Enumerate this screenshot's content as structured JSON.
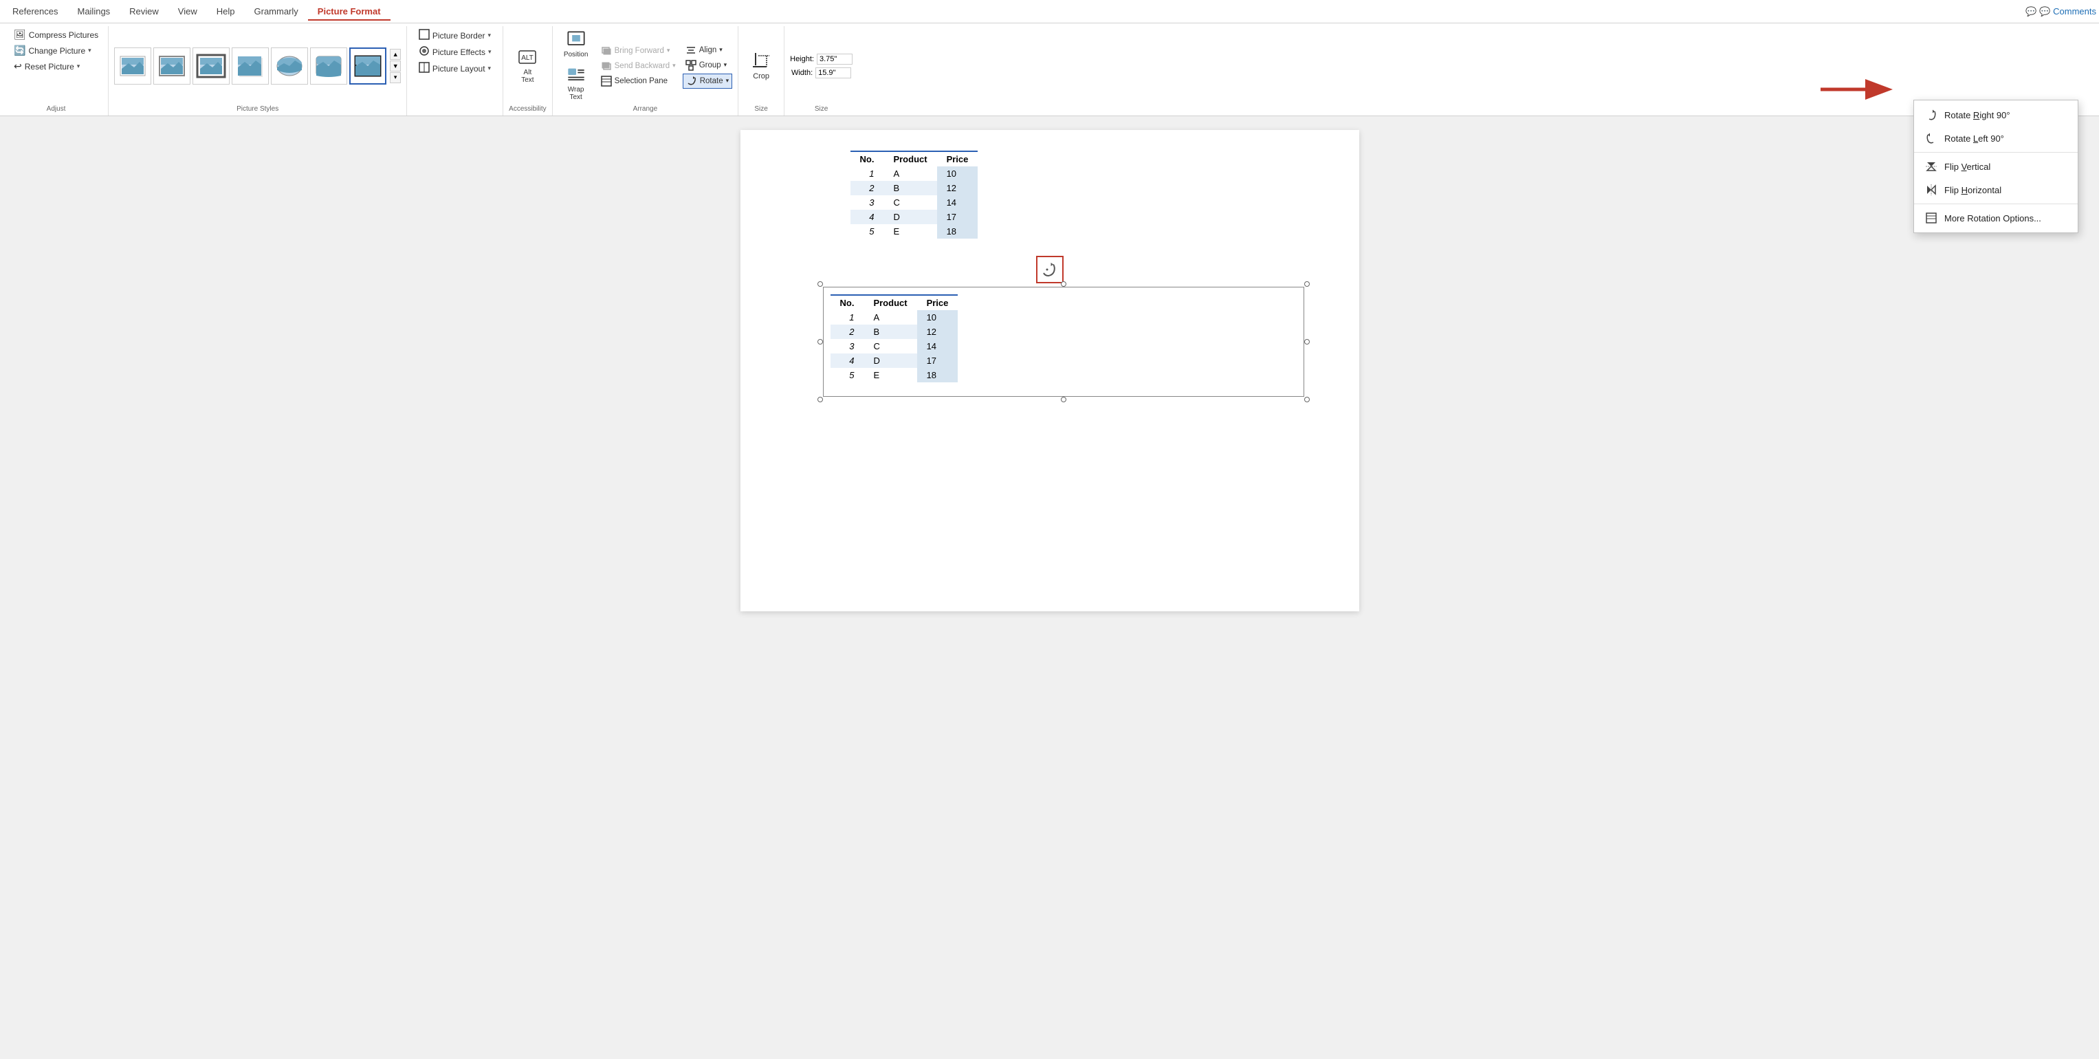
{
  "tabs": [
    {
      "label": "References",
      "active": false
    },
    {
      "label": "Mailings",
      "active": false
    },
    {
      "label": "Review",
      "active": false
    },
    {
      "label": "View",
      "active": false
    },
    {
      "label": "Help",
      "active": false
    },
    {
      "label": "Grammarly",
      "active": false
    },
    {
      "label": "Picture Format",
      "active": true
    }
  ],
  "comments_btn": "💬 Comments",
  "ribbon": {
    "compress_label": "Compress Pictures",
    "change_label": "Change Picture",
    "reset_label": "Reset Picture",
    "picture_border_label": "Picture Border",
    "picture_effects_label": "Picture Effects",
    "picture_layout_label": "Picture Layout",
    "alt_text_label": "Alt\nText",
    "accessibility_label": "Accessibility",
    "position_label": "Position",
    "wrap_text_label": "Wrap\nText",
    "bring_forward_label": "Bring Forward",
    "send_backward_label": "Send Backward",
    "selection_pane_label": "Selection Pane",
    "align_label": "Align",
    "group_label": "Group",
    "rotate_label": "Rotate",
    "arrange_label": "Arrange",
    "crop_label": "Crop",
    "height_label": "Height:",
    "height_value": "3.75\"",
    "width_label": "Width:",
    "width_value": "15.9\"",
    "size_label": "Size",
    "picture_styles_label": "Picture Styles"
  },
  "dropdown": {
    "rotate_right_90": "Rotate Right 90°",
    "rotate_left_90": "Rotate Left 90°",
    "flip_vertical": "Flip Vertical",
    "flip_horizontal": "Flip Horizontal",
    "more_options": "More Rotation Options..."
  },
  "table1": {
    "headers": [
      "No.",
      "Product",
      "Price"
    ],
    "rows": [
      [
        "1",
        "A",
        "10"
      ],
      [
        "2",
        "B",
        "12"
      ],
      [
        "3",
        "C",
        "14"
      ],
      [
        "4",
        "D",
        "17"
      ],
      [
        "5",
        "E",
        "18"
      ]
    ]
  },
  "table2": {
    "headers": [
      "No.",
      "Product",
      "Price"
    ],
    "rows": [
      [
        "1",
        "A",
        "10"
      ],
      [
        "2",
        "B",
        "12"
      ],
      [
        "3",
        "C",
        "14"
      ],
      [
        "4",
        "D",
        "17"
      ],
      [
        "5",
        "E",
        "18"
      ]
    ]
  }
}
